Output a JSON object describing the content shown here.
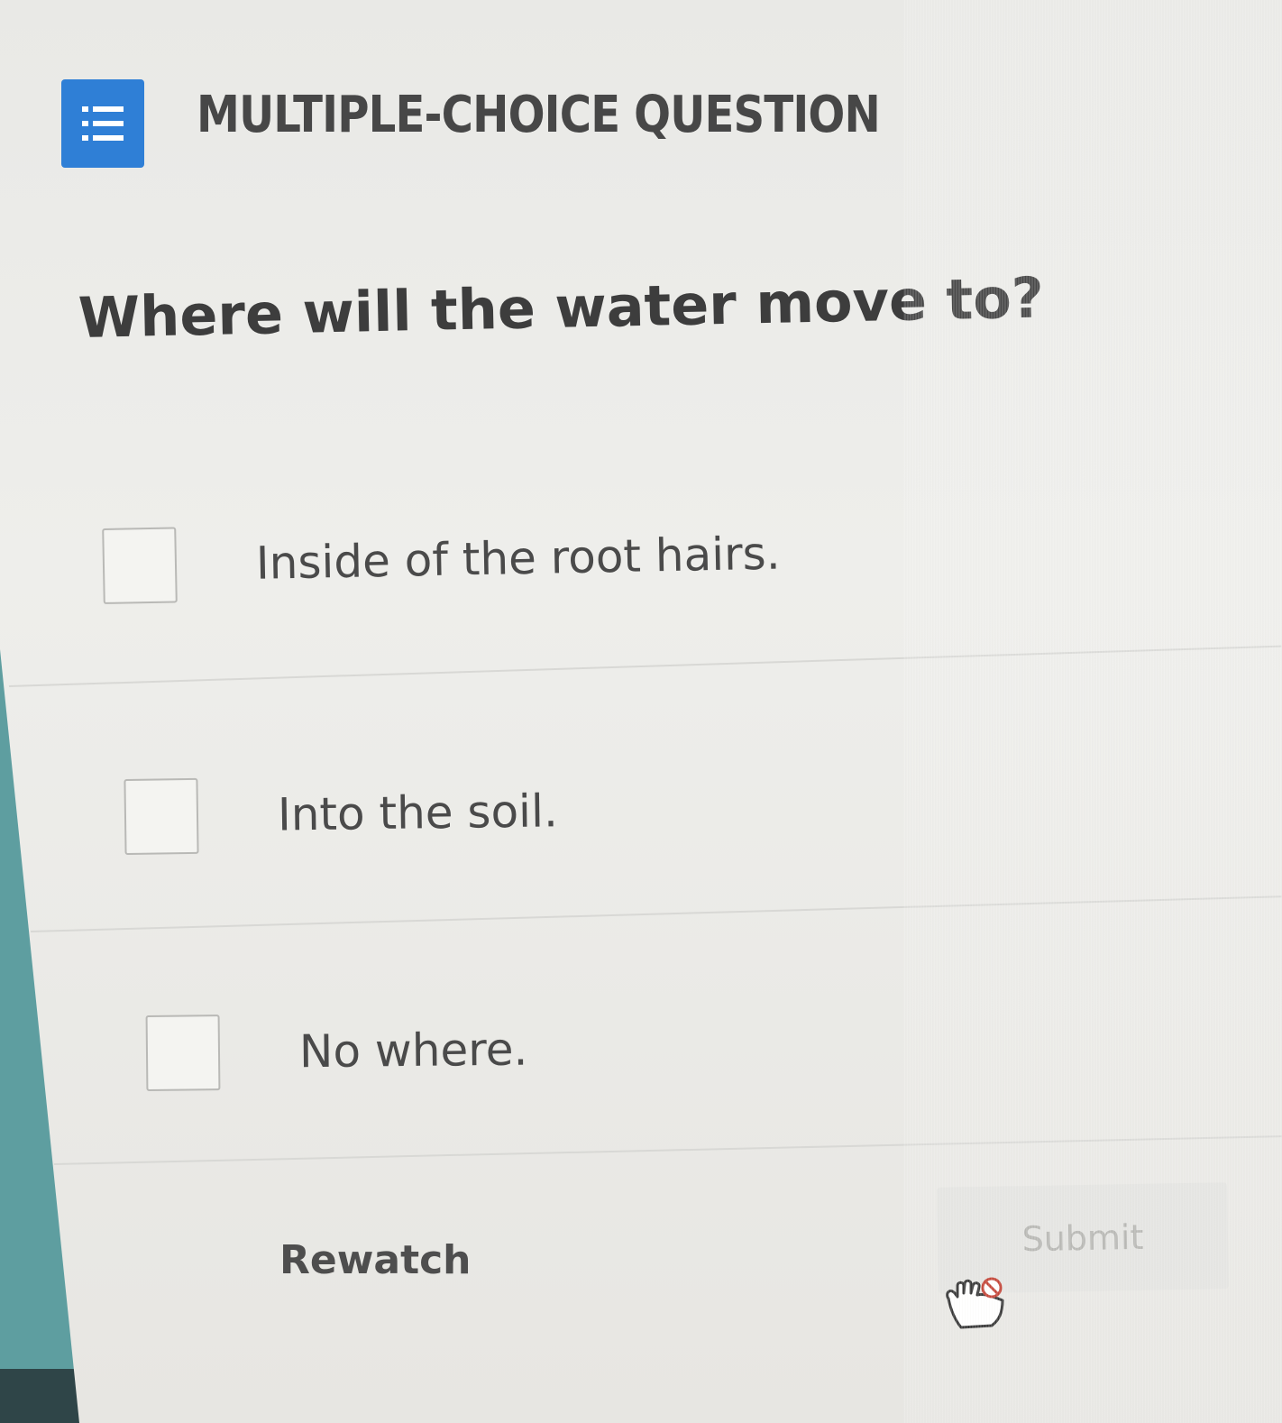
{
  "header": {
    "icon": "list-icon",
    "title": "MULTIPLE-CHOICE QUESTION",
    "accent_color": "#2f7fd6"
  },
  "question": {
    "text": "Where will the water move to?"
  },
  "options": [
    {
      "label": "Inside of the root hairs.",
      "checked": false
    },
    {
      "label": "Into the soil.",
      "checked": false
    },
    {
      "label": "No where.",
      "checked": false
    }
  ],
  "actions": {
    "rewatch_label": "Rewatch",
    "submit_label": "Submit",
    "submit_enabled": false
  },
  "cursor": {
    "icon": "not-allowed-hand-cursor-icon"
  }
}
